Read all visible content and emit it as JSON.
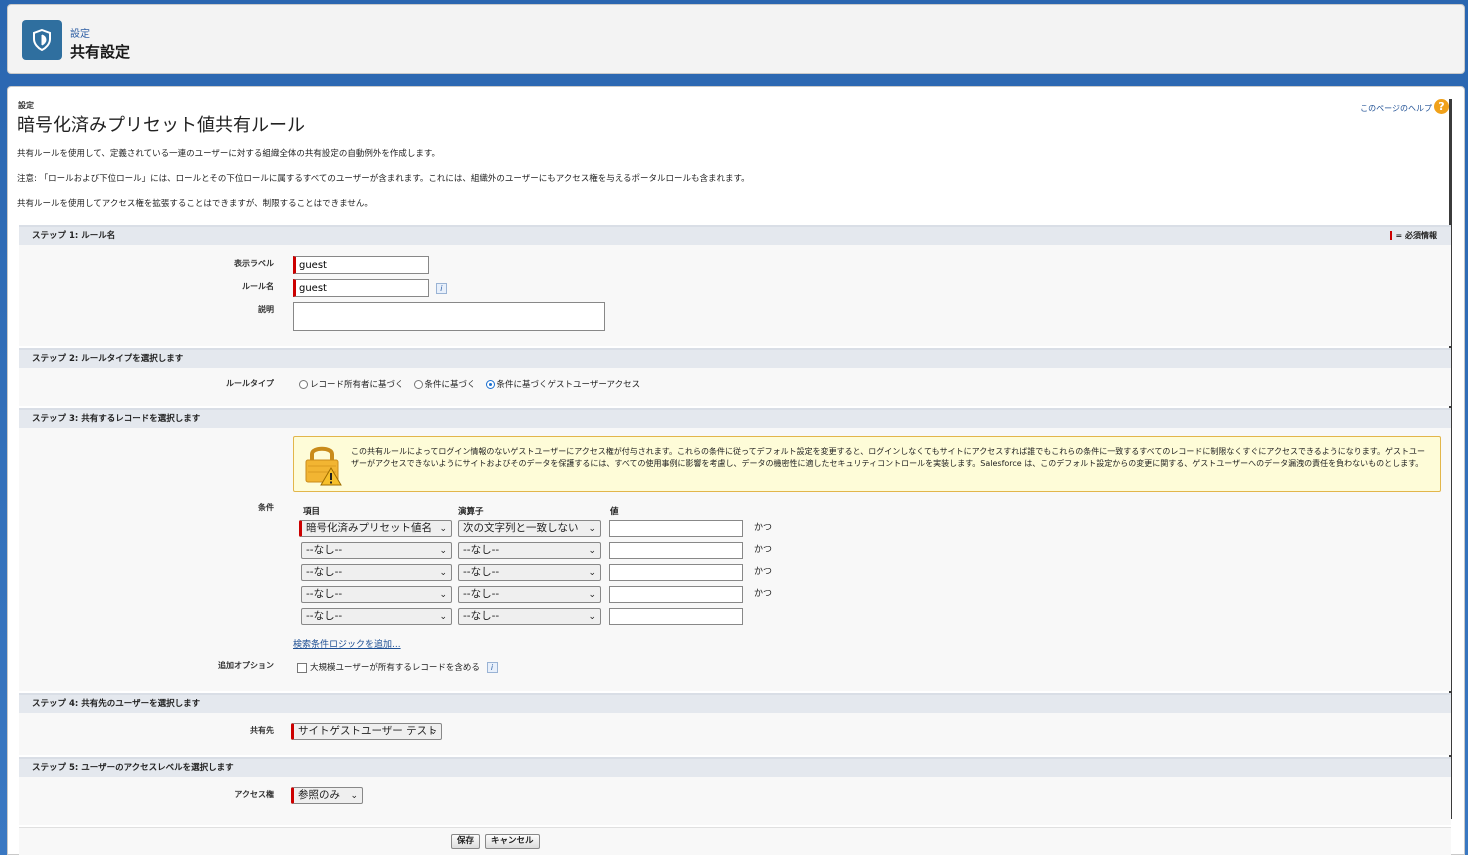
{
  "header": {
    "breadcrumb": "設定",
    "title": "共有設定"
  },
  "page": {
    "subtitle": "設定",
    "title": "暗号化済みプリセット値共有ルール",
    "help_link": "このページのヘルプ",
    "help_icon_text": "?",
    "description_1": "共有ルールを使用して、定義されている一連のユーザーに対する組織全体の共有設定の自動例外を作成します。",
    "description_2": "注意: 「ロールおよび下位ロール」には、ロールとその下位ロールに属するすべてのユーザーが含まれます。これには、組織外のユーザーにもアクセス権を与えるポータルロールも含まれます。",
    "description_3": "共有ルールを使用してアクセス権を拡張することはできますが、制限することはできません。"
  },
  "step1": {
    "heading": "ステップ 1: ルール名",
    "required_note": "= 必須情報",
    "label_display": "表示ラベル",
    "display_value": "guest",
    "label_rule_name": "ルール名",
    "rule_name_value": "guest",
    "info_glyph": "i",
    "label_description": "説明"
  },
  "step2": {
    "heading": "ステップ 2: ルールタイプを選択します",
    "label_rule_type": "ルールタイプ",
    "options": [
      {
        "label": "レコード所有者に基づく",
        "selected": false
      },
      {
        "label": "条件に基づく",
        "selected": false
      },
      {
        "label": "条件に基づくゲストユーザーアクセス",
        "selected": true
      }
    ]
  },
  "step3": {
    "heading": "ステップ 3: 共有するレコードを選択します",
    "warning": "この共有ルールによってログイン情報のないゲストユーザーにアクセス権が付与されます。これらの条件に従ってデフォルト設定を変更すると、ログインしなくてもサイトにアクセスすれば誰でもこれらの条件に一致するすべてのレコードに制限なくすぐにアクセスできるようになります。ゲストユーザーがアクセスできないようにサイトおよびそのデータを保護するには、すべての使用事例に影響を考慮し、データの機密性に適したセキュリティコントロールを実装します。Salesforce は、このデフォルト設定からの変更に関する、ゲストユーザーへのデータ漏洩の責任を負わないものとします。",
    "label_conditions": "条件",
    "col_field": "項目",
    "col_operator": "演算子",
    "col_value": "値",
    "and_label": "かつ",
    "rows": [
      {
        "field": "暗号化済みプリセット値名",
        "operator": "次の文字列と一致しない",
        "value": ""
      },
      {
        "field": "--なし--",
        "operator": "--なし--",
        "value": ""
      },
      {
        "field": "--なし--",
        "operator": "--なし--",
        "value": ""
      },
      {
        "field": "--なし--",
        "operator": "--なし--",
        "value": ""
      },
      {
        "field": "--なし--",
        "operator": "--なし--",
        "value": ""
      }
    ],
    "add_logic_link": "検索条件ロジックを追加...",
    "label_extra_options": "追加オプション",
    "checkbox_label": "大規模ユーザーが所有するレコードを含める"
  },
  "step4": {
    "heading": "ステップ 4: 共有先のユーザーを選択します",
    "label_share_with": "共有先",
    "share_with_value": "サイトゲストユーザー テスト"
  },
  "step5": {
    "heading": "ステップ 5: ユーザーのアクセスレベルを選択します",
    "label_access": "アクセス権",
    "access_value": "参照のみ"
  },
  "buttons": {
    "save": "保存",
    "cancel": "キャンセル"
  },
  "colors": {
    "brand_blue": "#2f6f9f",
    "required_red": "#cc0000",
    "warning_bg": "#fefcd8",
    "link_blue": "#1e4f94"
  }
}
